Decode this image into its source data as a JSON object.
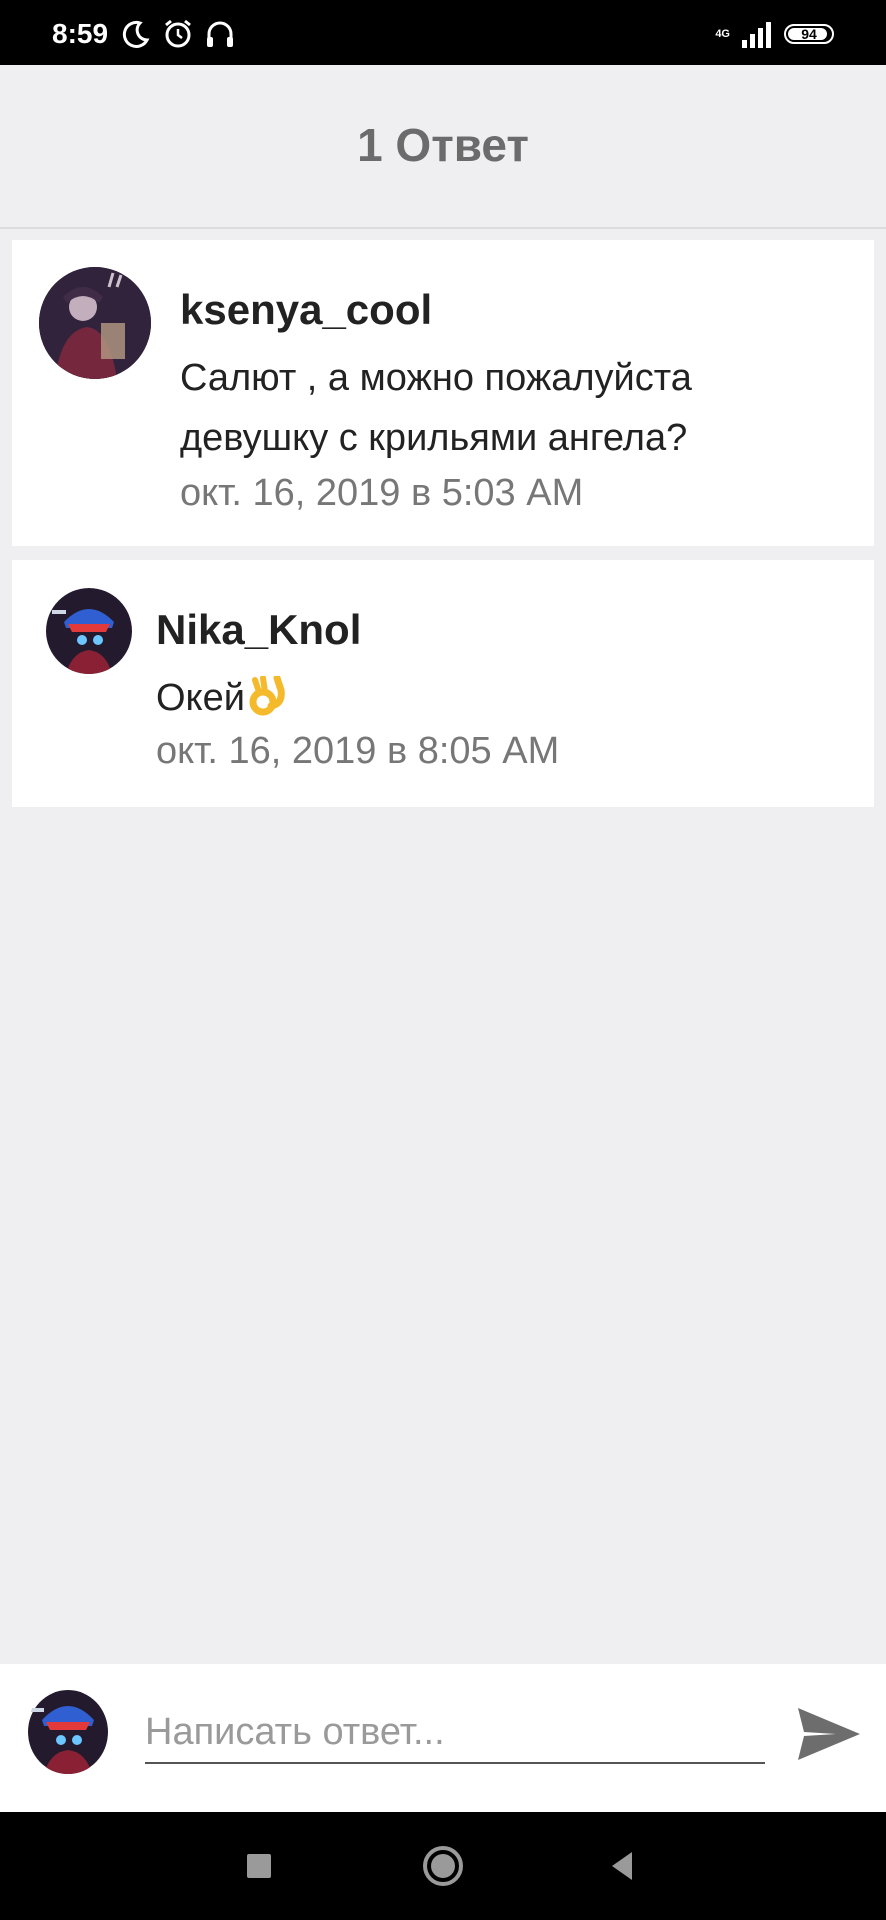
{
  "status_bar": {
    "time": "8:59",
    "network": "4G",
    "battery": "94",
    "battery_level": 0.94,
    "icons": [
      "moon-icon",
      "alarm-icon",
      "headphones-icon",
      "signal-icon",
      "battery-icon"
    ]
  },
  "header": {
    "title": "1 Ответ"
  },
  "comments": [
    {
      "username": "ksenya_cool",
      "text": "Салют , а можно пожалуйста девушку с крильями ангела?",
      "timestamp": "окт. 16, 2019 в 5:03 AM"
    },
    {
      "username": "Nika_Knol",
      "text": "Окей",
      "emoji": "ok-hand-emoji",
      "timestamp": "окт. 16, 2019 в 8:05 AM"
    }
  ],
  "reply": {
    "placeholder": "Написать ответ..."
  },
  "nav": {
    "buttons": [
      "recents-button",
      "home-button",
      "back-button"
    ]
  },
  "colors": {
    "background": "#efeef1",
    "card": "#ffffff",
    "text": "#222222",
    "muted": "#777777",
    "header_text": "#6b6b6b",
    "send_icon": "#6d6d6d"
  }
}
